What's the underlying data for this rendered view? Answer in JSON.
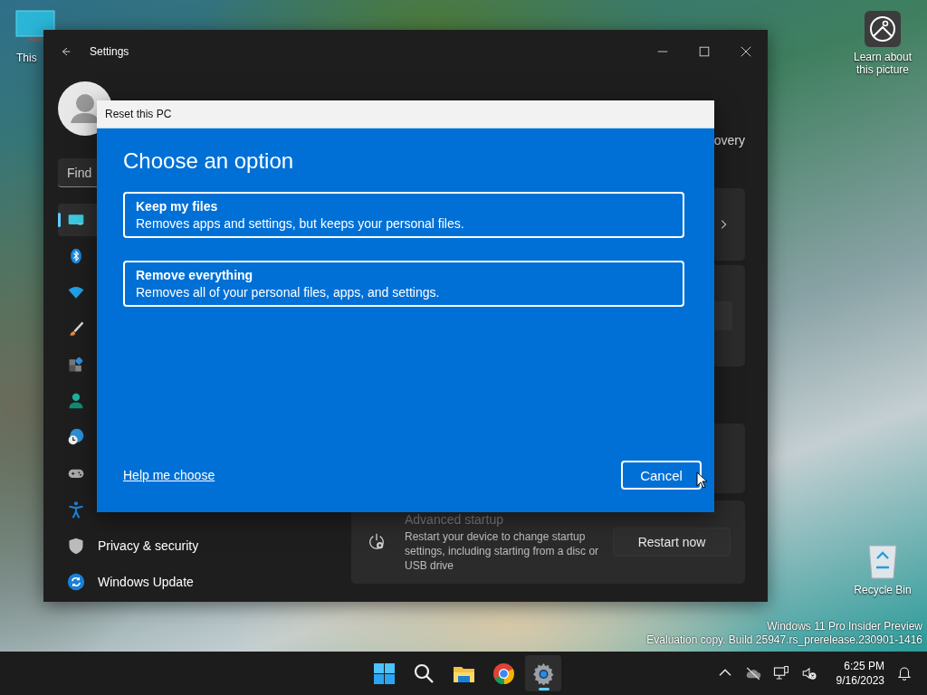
{
  "desktop_icons": [
    {
      "kind": "pc",
      "label": "This"
    },
    {
      "kind": "picture",
      "label": "Learn about this picture"
    },
    {
      "kind": "bin",
      "label": "Recycle Bin"
    }
  ],
  "settings_window": {
    "title": "Settings",
    "search": {
      "placeholder": "Find"
    },
    "breadcrumb_fragment": "overy",
    "nav": [
      {
        "kind": "system",
        "selected": true
      },
      {
        "kind": "bluetooth",
        "selected": false
      },
      {
        "kind": "network",
        "selected": false
      },
      {
        "kind": "brush",
        "selected": false
      },
      {
        "kind": "apps",
        "selected": false
      },
      {
        "kind": "account",
        "selected": false
      },
      {
        "kind": "time",
        "selected": false
      },
      {
        "kind": "gaming",
        "selected": false
      },
      {
        "kind": "accessibility",
        "selected": false
      },
      {
        "kind": "privacy",
        "label": "Privacy & security",
        "selected": false
      },
      {
        "kind": "update",
        "label": "Windows Update",
        "selected": false
      }
    ],
    "advanced_startup": {
      "title": "Advanced startup",
      "description": "Restart your device to change startup settings, including starting from a disc or USB drive",
      "button": "Restart now"
    }
  },
  "dialog": {
    "title": "Reset this PC",
    "heading": "Choose an option",
    "options": [
      {
        "title": "Keep my files",
        "description": "Removes apps and settings, but keeps your personal files."
      },
      {
        "title": "Remove everything",
        "description": "Removes all of your personal files, apps, and settings."
      }
    ],
    "help_link": "Help me choose",
    "cancel": "Cancel"
  },
  "watermark": [
    "Windows 11 Pro Insider Preview",
    "Evaluation copy. Build 25947.rs_prerelease.230901-1416"
  ],
  "taskbar": {
    "apps": [
      {
        "kind": "start",
        "selected": false
      },
      {
        "kind": "search",
        "selected": false
      },
      {
        "kind": "folder",
        "selected": false
      },
      {
        "kind": "browser",
        "selected": false
      },
      {
        "kind": "settings",
        "selected": true
      }
    ],
    "tray": [
      {
        "kind": "chevron"
      },
      {
        "kind": "cloud"
      },
      {
        "kind": "network"
      },
      {
        "kind": "volume"
      }
    ],
    "time": "6:25 PM",
    "date": "9/16/2023"
  }
}
